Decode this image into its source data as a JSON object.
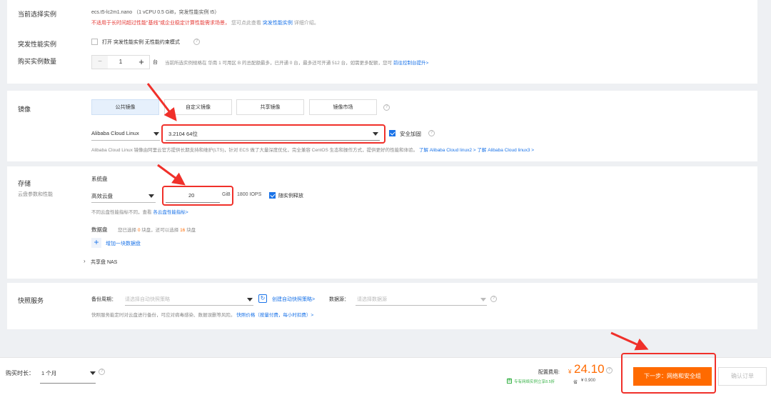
{
  "instance": {
    "label": "当前选择实例",
    "spec": "ecs.t5-lc2m1.nano （1 vCPU 0.5 GiB，突发性能实例 t5）",
    "warning": "不适用于长时间超过性能\"基线\"或企业稳定计算性能需求场景，",
    "warning_more": "您可点此查看",
    "warning_link": "突发性能实例",
    "warning_tail": "详细介绍。"
  },
  "burst": {
    "label": "突发性能实例",
    "option": "打开 突发性能实例 无性能约束模式"
  },
  "quantity": {
    "label": "购买实例数量",
    "minus": "−",
    "value": "1",
    "plus": "+",
    "unit": "台",
    "note": "当前所选实例规格在 华南 1 可用区 B 的总配额最多，已开通 0 台，最多还可开通 512 台，如需更多配额，您可",
    "note_link": "前往控制台提升>"
  },
  "image": {
    "label": "镜像",
    "tabs": [
      "公共镜像",
      "自定义镜像",
      "共享镜像",
      "镜像市场"
    ],
    "os": "Alibaba Cloud Linux",
    "version": "3.2104 64位",
    "security_label": "安全加固",
    "desc": "Alibaba Cloud Linux 镜像由阿里云官方提供长期支持和维护(LTS)，针对 ECS 做了大量深度优化，完全兼容 CentOS 生态和操作方式，提供更好的性能和体验。",
    "link1": "了解 Alibaba Cloud linux2 >",
    "link2": "了解 Alibaba Cloud linux3 >"
  },
  "storage": {
    "label": "存储",
    "sub": "云盘参数和性能",
    "system_disk": "系统盘",
    "disk_type": "高效云盘",
    "size": "20",
    "unit": "GiB",
    "iops": "1800 IOPS",
    "release": "随实例释放",
    "perf_note": "不同云盘性能指标不同，查看",
    "perf_link": "各云盘性能指标>",
    "data_disk": "数据盘",
    "data_note_pre": "您已选择",
    "data_selected": "0",
    "data_note_mid": "块盘，还可以选择",
    "data_remaining": "16",
    "data_note_tail": "块盘",
    "add_label": "增加一块数据盘",
    "nas_label": "共享盘 NAS"
  },
  "snapshot": {
    "label": "快照服务",
    "backup_label": "备份周期：",
    "backup_placeholder": "请选择自动快照策略",
    "create_link": "创建自动快照策略>",
    "datasource_label": "数据源：",
    "datasource_placeholder": "请选择数据源",
    "note": "快照服务能定时对云盘进行备份，可应对病毒感染、数据误删等风险。",
    "note_link": "快照价格（按量付费，每小时扣费）>"
  },
  "footer": {
    "duration_label": "购买时长：",
    "duration_value": "1 个月",
    "config_label": "配置费用:",
    "currency": "¥",
    "price": "24.10",
    "save_note": "专有网络实例立享8.5折",
    "save_prefix": "省",
    "save_value": "¥ 0.900",
    "next_button": "下一步：网络和安全组",
    "confirm_button": "确认订单"
  },
  "colors": {
    "accent": "#1a73e8",
    "warning_red": "#e53935",
    "price_orange": "#ff6a00",
    "annotation_red": "#f0302a"
  }
}
